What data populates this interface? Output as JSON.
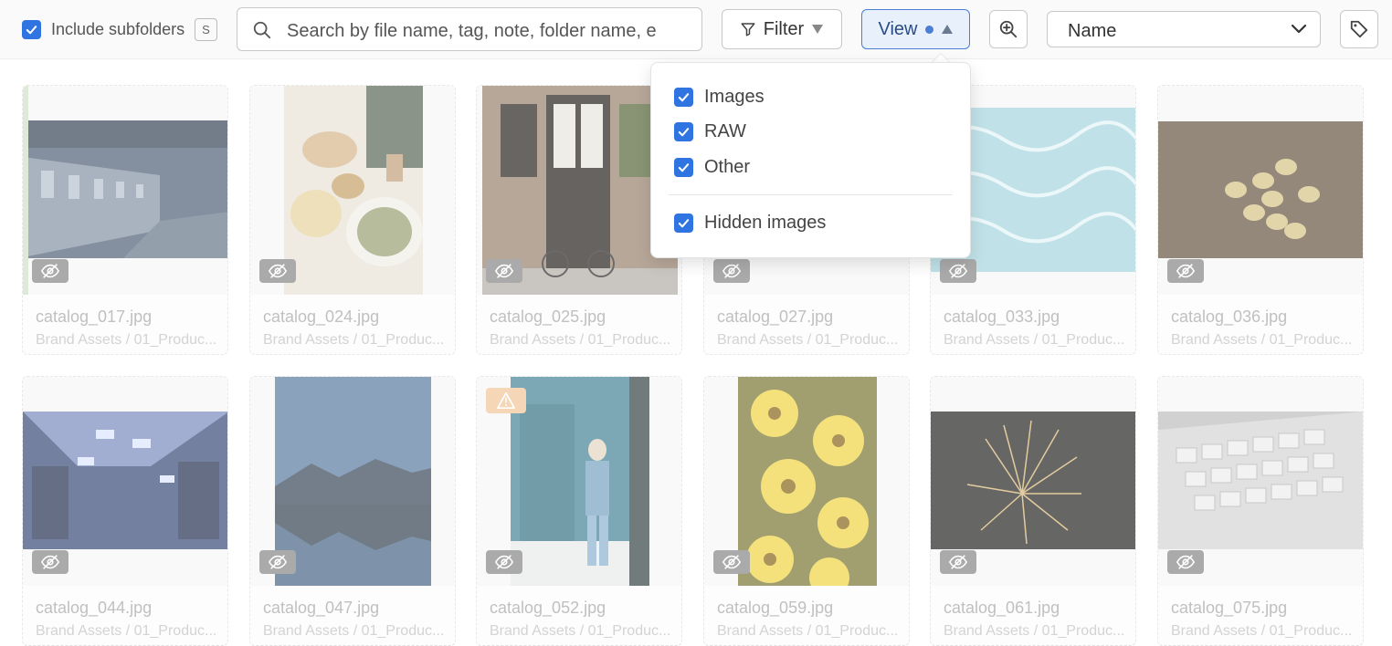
{
  "toolbar": {
    "include_subfolders_label": "Include subfolders",
    "include_subfolders_checked": true,
    "shortcut_key": "S",
    "search_placeholder": "Search by file name, tag, note, folder name, e",
    "filter_label": "Filter",
    "view_label": "View",
    "sort_value": "Name",
    "accent_color": "#2f74e0"
  },
  "view_menu": {
    "items": [
      {
        "label": "Images",
        "checked": true
      },
      {
        "label": "RAW",
        "checked": true
      },
      {
        "label": "Other",
        "checked": true
      }
    ],
    "hidden_images": {
      "label": "Hidden images",
      "checked": true
    }
  },
  "icons": {
    "search": "search-icon",
    "filter": "funnel-icon",
    "zoom": "zoom-in-icon",
    "tag": "tag-icon",
    "hidden": "eye-slash-icon",
    "warning": "warning-icon"
  },
  "cards": [
    {
      "name": "catalog_017.jpg",
      "path": "Brand Assets / 01_Produc..."
    },
    {
      "name": "catalog_024.jpg",
      "path": "Brand Assets / 01_Produc..."
    },
    {
      "name": "catalog_025.jpg",
      "path": "Brand Assets / 01_Produc..."
    },
    {
      "name": "catalog_027.jpg",
      "path": "Brand Assets / 01_Produc..."
    },
    {
      "name": "catalog_033.jpg",
      "path": "Brand Assets / 01_Produc..."
    },
    {
      "name": "catalog_036.jpg",
      "path": "Brand Assets / 01_Produc..."
    },
    {
      "name": "catalog_044.jpg",
      "path": "Brand Assets / 01_Produc..."
    },
    {
      "name": "catalog_047.jpg",
      "path": "Brand Assets / 01_Produc..."
    },
    {
      "name": "catalog_052.jpg",
      "path": "Brand Assets / 01_Produc..."
    },
    {
      "name": "catalog_059.jpg",
      "path": "Brand Assets / 01_Produc..."
    },
    {
      "name": "catalog_061.jpg",
      "path": "Brand Assets / 01_Produc..."
    },
    {
      "name": "catalog_075.jpg",
      "path": "Brand Assets / 01_Produc..."
    }
  ]
}
